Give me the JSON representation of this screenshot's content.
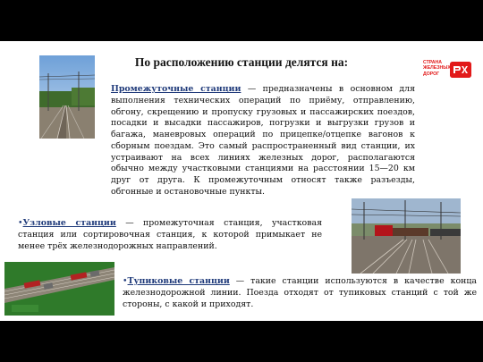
{
  "slide": {
    "title": "По расположению станции делятся на:",
    "logo": {
      "line1": "СТРАНА",
      "line2": "ЖЕЛЕЗНЫХ",
      "line3": "ДОРОГ",
      "mark_text": "РЖД",
      "brand_color": "#e21a1a"
    },
    "paragraphs": {
      "intermediate": {
        "term": "Промежуточные станции",
        "body": " — предназначены в основном для выполнения технических операций по приёму, отправлению, обгону, скрещению и пропуску грузовых и пассажирских поездов, посадки и высадки пассажиров, погрузки и выгрузки грузов и багажа, маневровых операций по прицепке/отцепке вагонов к сборным поездам. Это самый распространенный вид станции, их устраивают на всех линиях железных дорог, располагаются обычно между участковыми станциями на расстоянии 15—20 км друг от друга. К промежуточным относят также разъезды, обгонные и остановочные пункты."
      },
      "junction": {
        "bullet": "•",
        "term": "Узловые станции",
        "body": " — промежуточная станция, участковая станция или сортировочная станция, к которой примыкает не менее трёх железнодорожных направлений."
      },
      "terminal": {
        "bullet": "•",
        "term": "Тупиковые станции",
        "body": " — такие станции используются в качестве конца железнодорожной линии. Поезда отходят от тупиковых станций с той же стороны, с какой и приходят."
      }
    },
    "photos": {
      "top": "railway-intermediate-station-photo",
      "right": "railway-junction-station-photo",
      "bottom": "railway-terminal-station-scheme"
    }
  }
}
